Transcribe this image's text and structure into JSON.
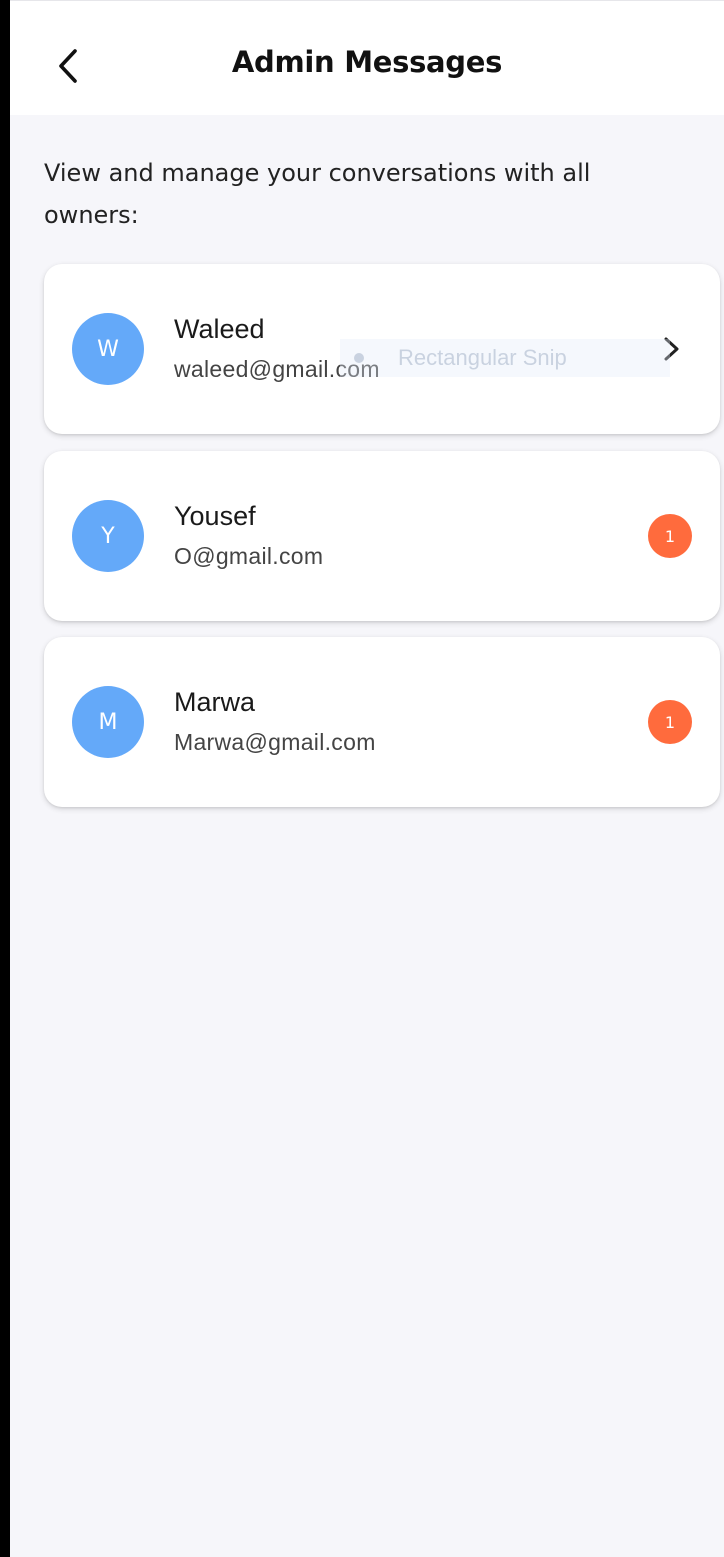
{
  "header": {
    "title": "Admin Messages",
    "back_icon": "chevron-left-icon"
  },
  "intro_text": "View and manage your conversations with all owners:",
  "owners": [
    {
      "initial": "W",
      "name": "Waleed",
      "email": "waleed@gmail.com",
      "indicator": "chevron-right-icon",
      "unread": null
    },
    {
      "initial": "Y",
      "name": "Yousef",
      "email": "O@gmail.com",
      "indicator": "badge",
      "unread": "1"
    },
    {
      "initial": "M",
      "name": "Marwa",
      "email": "Marwa@gmail.com",
      "indicator": "badge",
      "unread": "1"
    }
  ],
  "overlay": {
    "label": "Rectangular Snip"
  },
  "colors": {
    "avatar": "#64a9f9",
    "badge": "#ff6b3d",
    "background": "#f6f6fa",
    "card": "#ffffff"
  }
}
